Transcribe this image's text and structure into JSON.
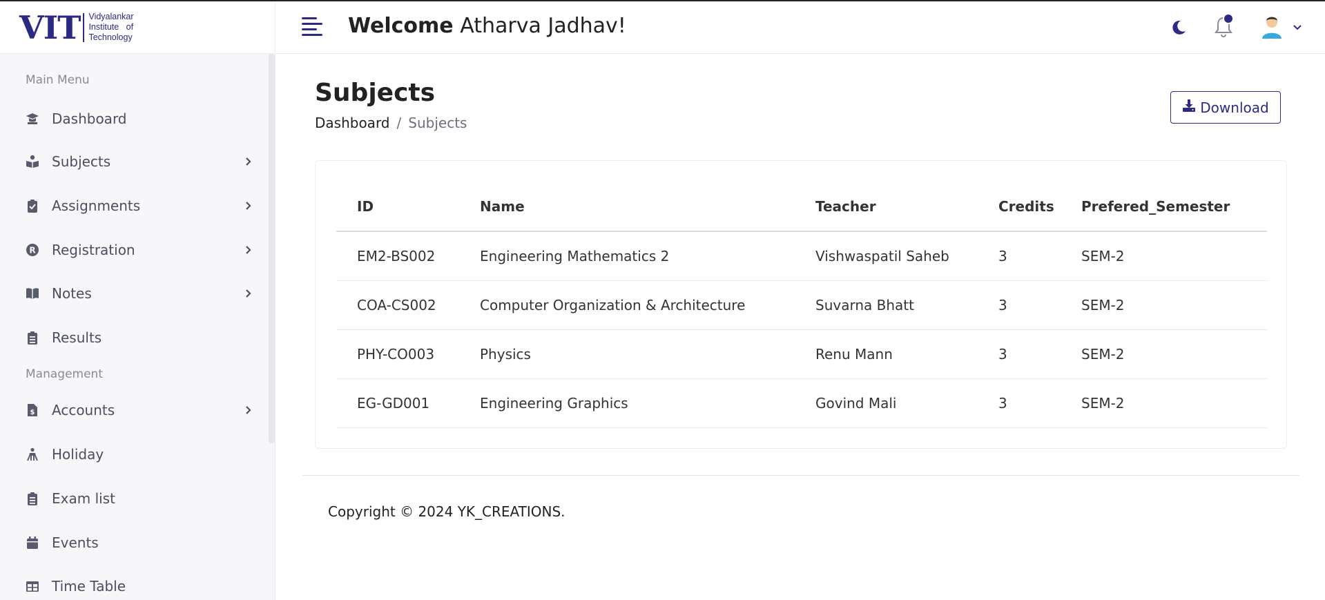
{
  "logo": {
    "abbr": "VIT",
    "line1": "Vidyalankar",
    "line2": "Institute   of",
    "line3": "Technology"
  },
  "sidebar": {
    "section_main": "Main Menu",
    "section_management": "Management",
    "items": [
      {
        "label": "Dashboard",
        "icon": "graduation-cap-icon",
        "has_submenu": false
      },
      {
        "label": "Subjects",
        "icon": "book-reader-icon",
        "has_submenu": true
      },
      {
        "label": "Assignments",
        "icon": "clipboard-check-icon",
        "has_submenu": true
      },
      {
        "label": "Registration",
        "icon": "registered-icon",
        "has_submenu": true
      },
      {
        "label": "Notes",
        "icon": "book-open-icon",
        "has_submenu": true
      },
      {
        "label": "Results",
        "icon": "clipboard-list-icon",
        "has_submenu": false
      },
      {
        "label": "Accounts",
        "icon": "file-invoice-dollar-icon",
        "has_submenu": true
      },
      {
        "label": "Holiday",
        "icon": "holiday-icon",
        "has_submenu": false
      },
      {
        "label": "Exam list",
        "icon": "clipboard-list-icon",
        "has_submenu": false
      },
      {
        "label": "Events",
        "icon": "calendar-icon",
        "has_submenu": false
      },
      {
        "label": "Time Table",
        "icon": "table-icon",
        "has_submenu": false
      }
    ]
  },
  "header": {
    "welcome_bold": "Welcome",
    "user_name": "Atharva Jadhav!"
  },
  "page": {
    "title": "Subjects",
    "breadcrumb": [
      "Dashboard",
      "Subjects"
    ],
    "breadcrumb_sep": "/",
    "download_label": "Download"
  },
  "table": {
    "columns": [
      "ID",
      "Name",
      "Teacher",
      "Credits",
      "Prefered_Semester"
    ],
    "rows": [
      [
        "EM2-BS002",
        "Engineering Mathematics 2",
        "Vishwaspatil Saheb",
        "3",
        "SEM-2"
      ],
      [
        "COA-CS002",
        "Computer Organization & Architecture",
        "Suvarna Bhatt",
        "3",
        "SEM-2"
      ],
      [
        "PHY-CO003",
        "Physics",
        "Renu Mann",
        "3",
        "SEM-2"
      ],
      [
        "EG-GD001",
        "Engineering Graphics",
        "Govind Mali",
        "3",
        "SEM-2"
      ]
    ]
  },
  "footer": {
    "copyright": "Copyright © 2024 YK_CREATIONS."
  },
  "colors": {
    "brand": "#2d2a86",
    "sidebar_bg": "#f7f7fa",
    "text": "#333333"
  }
}
